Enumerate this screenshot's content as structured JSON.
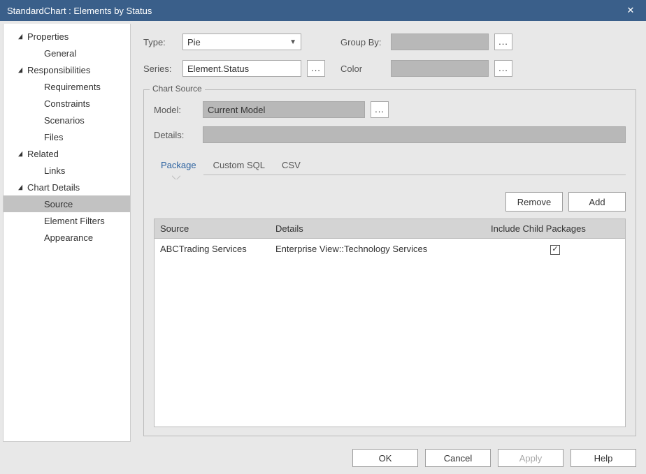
{
  "title": "StandardChart : Elements by Status",
  "sidebar": [
    {
      "label": "Properties",
      "level": 1,
      "expandable": true
    },
    {
      "label": "General",
      "level": 2,
      "expandable": false
    },
    {
      "label": "Responsibilities",
      "level": 1,
      "expandable": true
    },
    {
      "label": "Requirements",
      "level": 2,
      "expandable": false
    },
    {
      "label": "Constraints",
      "level": 2,
      "expandable": false
    },
    {
      "label": "Scenarios",
      "level": 2,
      "expandable": false
    },
    {
      "label": "Files",
      "level": 2,
      "expandable": false
    },
    {
      "label": "Related",
      "level": 1,
      "expandable": true
    },
    {
      "label": "Links",
      "level": 2,
      "expandable": false
    },
    {
      "label": "Chart Details",
      "level": 1,
      "expandable": true
    },
    {
      "label": "Source",
      "level": 2,
      "expandable": false,
      "selected": true
    },
    {
      "label": "Element Filters",
      "level": 2,
      "expandable": false
    },
    {
      "label": "Appearance",
      "level": 2,
      "expandable": false
    }
  ],
  "top": {
    "type_label": "Type:",
    "type_value": "Pie",
    "series_label": "Series:",
    "series_value": "Element.Status",
    "groupby_label": "Group By:",
    "color_label": "Color",
    "ellipsis": "..."
  },
  "fieldset": {
    "legend": "Chart Source",
    "model_label": "Model:",
    "model_value": "Current Model",
    "details_label": "Details:",
    "tabs": [
      "Package",
      "Custom SQL",
      "CSV"
    ],
    "active_tab": 0,
    "remove": "Remove",
    "add": "Add",
    "columns": {
      "source": "Source",
      "details": "Details",
      "include": "Include Child Packages"
    },
    "rows": [
      {
        "source": "ABCTrading Services",
        "details": "Enterprise View::Technology Services",
        "include": true
      }
    ]
  },
  "footer": {
    "ok": "OK",
    "cancel": "Cancel",
    "apply": "Apply",
    "help": "Help"
  }
}
